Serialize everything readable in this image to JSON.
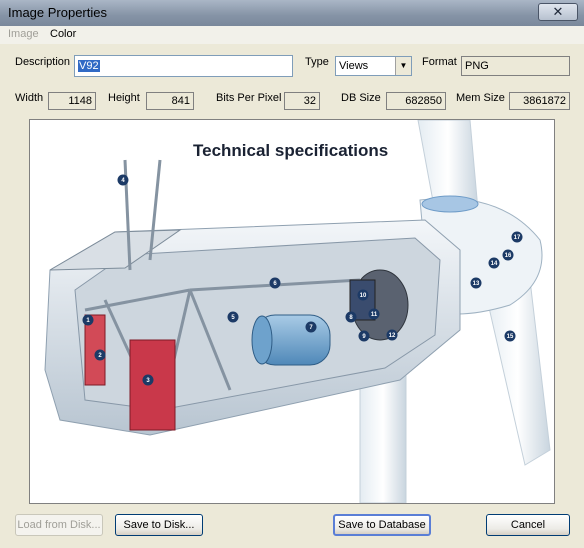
{
  "window": {
    "title": "Image Properties",
    "close_glyph": "✕"
  },
  "menu": {
    "items": [
      {
        "label": "Image",
        "enabled": false
      },
      {
        "label": "Color",
        "enabled": true
      }
    ]
  },
  "fields": {
    "description_label": "Description",
    "description_value": "V92",
    "type_label": "Type",
    "type_value": "Views",
    "format_label": "Format",
    "format_value": "PNG",
    "width_label": "Width",
    "width_value": "1148",
    "height_label": "Height",
    "height_value": "841",
    "bpp_label": "Bits Per Pixel",
    "bpp_value": "32",
    "dbsize_label": "DB Size",
    "dbsize_value": "682850",
    "memsize_label": "Mem Size",
    "memsize_value": "3861872"
  },
  "image": {
    "heading": "Technical specifications",
    "markers": [
      "1",
      "2",
      "3",
      "4",
      "5",
      "6",
      "7",
      "8",
      "9",
      "10",
      "11",
      "12",
      "13",
      "14",
      "15",
      "16",
      "17"
    ]
  },
  "buttons": {
    "load_label": "Load from Disk...",
    "save_disk_label": "Save to Disk...",
    "save_db_label": "Save to Database",
    "cancel_label": "Cancel"
  }
}
